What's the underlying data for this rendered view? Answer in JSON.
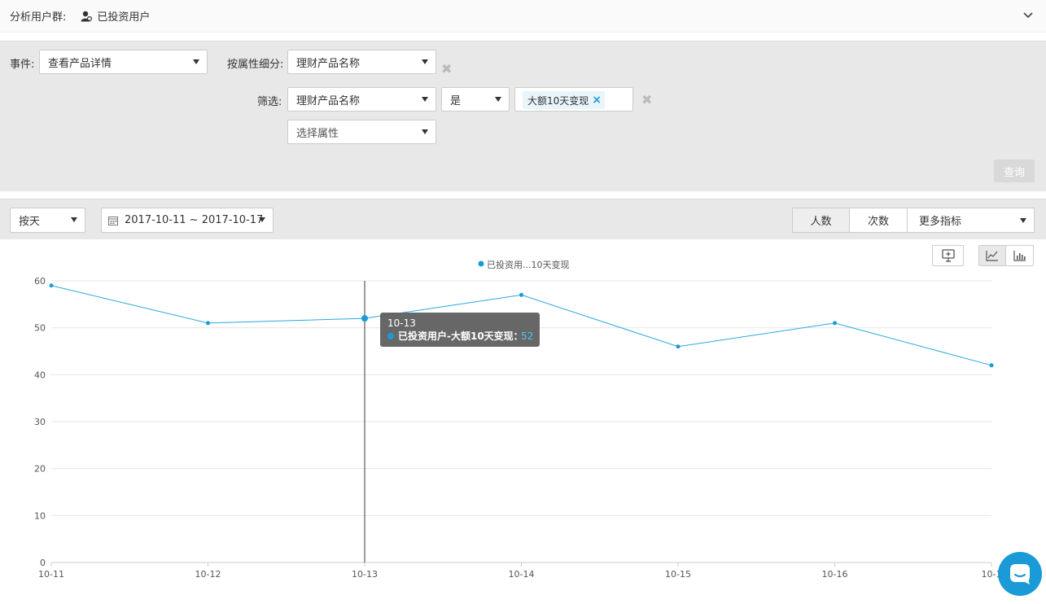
{
  "header": {
    "group_label": "分析用户群:",
    "group_value": "已投资用户"
  },
  "filters": {
    "event_label": "事件:",
    "event_value": "查看产品详情",
    "breakdown_label": "按属性细分:",
    "breakdown_value": "理财产品名称",
    "filter_label": "筛选:",
    "filter_property": "理财产品名称",
    "filter_operator": "是",
    "filter_tag": "大额10天变现",
    "select_property_placeholder": "选择属性",
    "query_button": "查询"
  },
  "controls": {
    "granularity": "按天",
    "date_range": "2017-10-11 ~ 2017-10-17",
    "metric_tabs": [
      "人数",
      "次数"
    ],
    "more_metrics": "更多指标"
  },
  "colors": {
    "accent": "#1a9bd7",
    "line": "#2aa8e0",
    "tooltip_bg": "#5f5f5f"
  },
  "tooltip": {
    "date": "10-13",
    "series_label": "已投资用户-大额10天变现：",
    "value": "52"
  },
  "chart_data": {
    "type": "line",
    "legend": "已投资用...10天变现",
    "categories": [
      "10-11",
      "10-12",
      "10-13",
      "10-14",
      "10-15",
      "10-16",
      "10-1"
    ],
    "series": [
      {
        "name": "已投资用户-大额10天变现",
        "values": [
          59,
          51,
          52,
          57,
          46,
          51,
          42
        ]
      }
    ],
    "y_ticks": [
      "0",
      "10",
      "20",
      "30",
      "40",
      "50",
      "60"
    ],
    "ylim": [
      0,
      60
    ],
    "grid": true,
    "highlight_index": 2
  }
}
